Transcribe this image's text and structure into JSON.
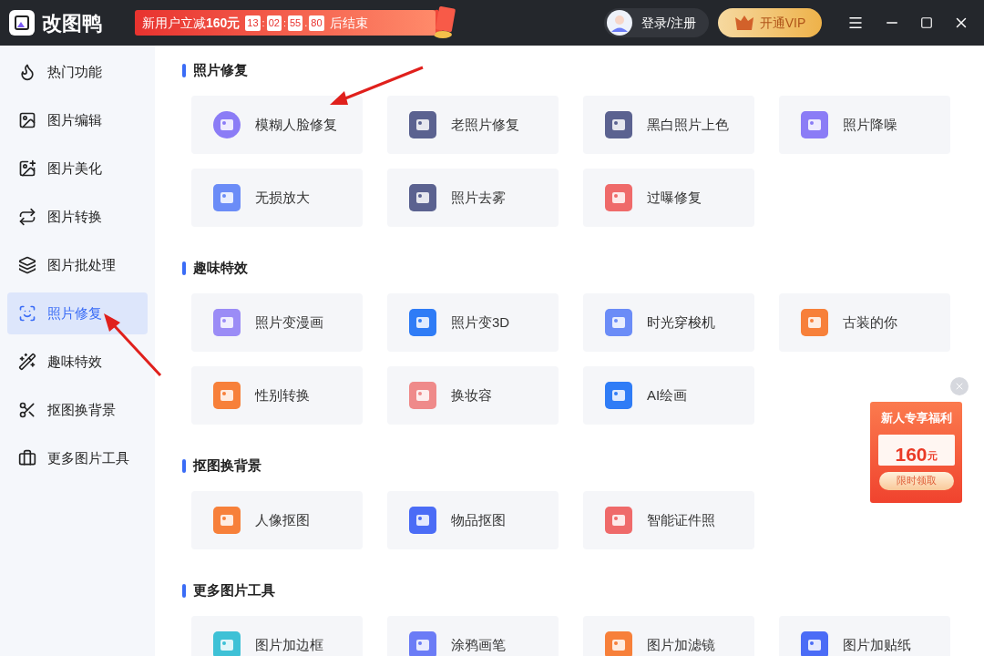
{
  "app": {
    "name": "改图鸭"
  },
  "promo_banner": {
    "text": "新用户立减**160元**",
    "timer": [
      "13",
      ":",
      "02",
      ":",
      "55",
      ".",
      "80"
    ],
    "suffix": "后结束"
  },
  "account": {
    "login": "登录/注册",
    "vip": "开通VIP"
  },
  "sidebar": {
    "items": [
      {
        "label": "热门功能",
        "selected": false
      },
      {
        "label": "图片编辑",
        "selected": false
      },
      {
        "label": "图片美化",
        "selected": false
      },
      {
        "label": "图片转换",
        "selected": false
      },
      {
        "label": "图片批处理",
        "selected": false
      },
      {
        "label": "照片修复",
        "selected": true
      },
      {
        "label": "趣味特效",
        "selected": false
      },
      {
        "label": "抠图换背景",
        "selected": false
      },
      {
        "label": "更多图片工具",
        "selected": false
      }
    ]
  },
  "sections": [
    {
      "title": "照片修复",
      "tools": [
        "模糊人脸修复",
        "老照片修复",
        "黑白照片上色",
        "照片降噪",
        "无损放大",
        "照片去雾",
        "过曝修复"
      ]
    },
    {
      "title": "趣味特效",
      "tools": [
        "照片变漫画",
        "照片变3D",
        "时光穿梭机",
        "古装的你",
        "性别转换",
        "换妆容",
        "AI绘画"
      ]
    },
    {
      "title": "抠图换背景",
      "tools": [
        "人像抠图",
        "物品抠图",
        "智能证件照"
      ]
    },
    {
      "title": "更多图片工具",
      "tools": [
        "图片加边框",
        "涂鸦画笔",
        "图片加滤镜",
        "图片加贴纸"
      ]
    }
  ],
  "gift_popup": {
    "title": "新人专享福利",
    "amount": "160",
    "unit": "元",
    "button": "限时领取"
  }
}
